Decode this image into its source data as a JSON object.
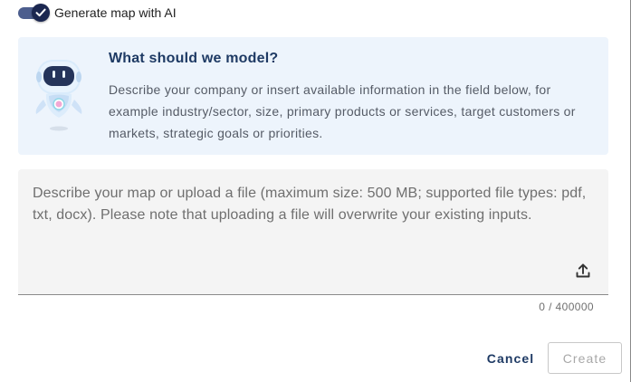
{
  "toggle": {
    "label": "Generate map with AI",
    "checked": true,
    "icon": "check-icon",
    "track_color": "#4d5e8e",
    "knob_color": "#1b2750"
  },
  "info": {
    "title": "What should we model?",
    "body": "Describe your company or insert available information in the field below, for example industry/sector, size, primary products or services, target customers or markets, strategic goals or priorities.",
    "icon": "robot-icon",
    "background": "#edf4fc"
  },
  "input": {
    "value": "",
    "placeholder": "Describe your map or upload a file (maximum size: 500 MB; supported file types: pdf, txt, docx). Please note that uploading a file will overwrite your existing inputs.",
    "upload_icon": "upload-icon",
    "counter": "0 / 400000"
  },
  "actions": {
    "cancel_label": "Cancel",
    "create_label": "Create",
    "create_disabled": true,
    "accent": "#1e3a64"
  }
}
